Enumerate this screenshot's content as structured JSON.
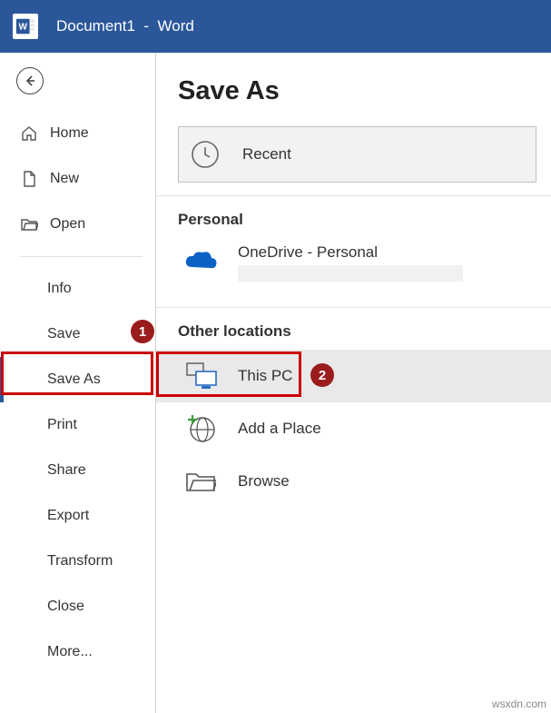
{
  "titlebar": {
    "document": "Document1",
    "sep": "-",
    "app": "Word"
  },
  "sidebar": {
    "home": "Home",
    "new": "New",
    "open": "Open",
    "info": "Info",
    "save": "Save",
    "saveas": "Save As",
    "print": "Print",
    "share": "Share",
    "export": "Export",
    "transform": "Transform",
    "close": "Close",
    "more": "More..."
  },
  "page": {
    "title": "Save As"
  },
  "sections": {
    "personal": "Personal",
    "other": "Other locations"
  },
  "locations": {
    "recent": "Recent",
    "onedrive": "OneDrive - Personal",
    "thispc": "This PC",
    "addplace": "Add a Place",
    "browse": "Browse"
  },
  "annotations": {
    "n1": "1",
    "n2": "2"
  },
  "watermark": "wsxdn.com"
}
